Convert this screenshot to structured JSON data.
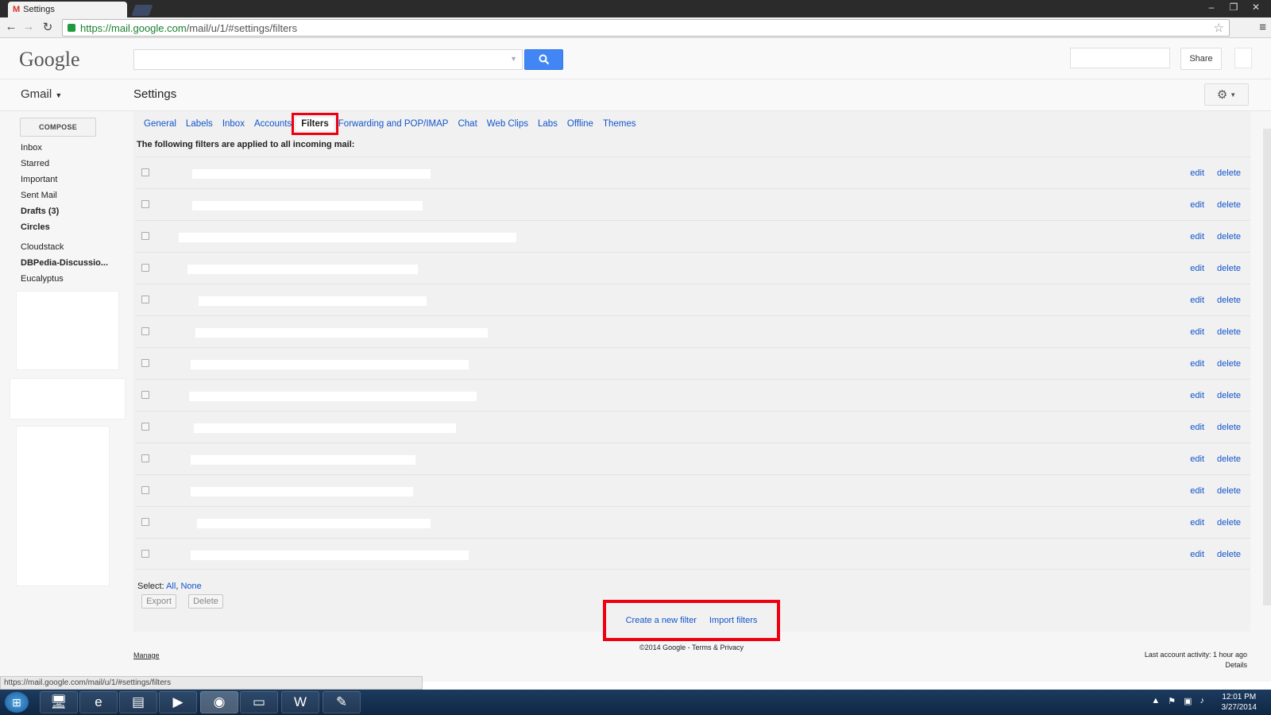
{
  "browser": {
    "tab_title": "Settings",
    "tab_icon": "gmail-icon",
    "url_scheme": "https://",
    "url_host": "mail.google.com",
    "url_path": "/mail/u/1/#settings/filters",
    "status_url": "https://mail.google.com/mail/u/1/#settings/filters"
  },
  "header": {
    "logo": "Google",
    "share_label": "Share"
  },
  "subheader": {
    "app_name": "Gmail",
    "page_title": "Settings"
  },
  "sidebar": {
    "compose_label": "COMPOSE",
    "items": [
      {
        "label": "Inbox",
        "bold": false
      },
      {
        "label": "Starred",
        "bold": false
      },
      {
        "label": "Important",
        "bold": false
      },
      {
        "label": "Sent Mail",
        "bold": false
      },
      {
        "label": "Drafts (3)",
        "bold": true
      },
      {
        "label": "Circles",
        "bold": true
      },
      {
        "label": "Cloudstack",
        "bold": false
      },
      {
        "label": "DBPedia-Discussio...",
        "bold": true
      },
      {
        "label": "Eucalyptus",
        "bold": false
      }
    ]
  },
  "tabs": [
    {
      "label": "General",
      "active": false
    },
    {
      "label": "Labels",
      "active": false
    },
    {
      "label": "Inbox",
      "active": false
    },
    {
      "label": "Accounts",
      "active": false
    },
    {
      "label": "Filters",
      "active": true
    },
    {
      "label": "Forwarding and POP/IMAP",
      "active": false
    },
    {
      "label": "Chat",
      "active": false
    },
    {
      "label": "Web Clips",
      "active": false
    },
    {
      "label": "Labs",
      "active": false
    },
    {
      "label": "Offline",
      "active": false
    },
    {
      "label": "Themes",
      "active": false
    }
  ],
  "filters": {
    "intro": "The following filters are applied to all incoming mail:",
    "edit_label": "edit",
    "delete_label": "delete",
    "row_count": 13
  },
  "selection": {
    "prefix": "Select:",
    "all": "All",
    "none": "None",
    "export_label": "Export",
    "delete_label": "Delete"
  },
  "actions": {
    "create_filter": "Create a new filter",
    "import_filters": "Import filters"
  },
  "footer": {
    "manage": "Manage",
    "copyright": "©2014 Google - ",
    "terms": "Terms & Privacy",
    "last_activity": "Last account activity: 1 hour ago",
    "details": "Details"
  },
  "taskbar": {
    "time": "12:01 PM",
    "date": "3/27/2014"
  },
  "colors": {
    "link": "#1155cc",
    "highlight": "#ee0011",
    "search_button": "#4285f4"
  }
}
